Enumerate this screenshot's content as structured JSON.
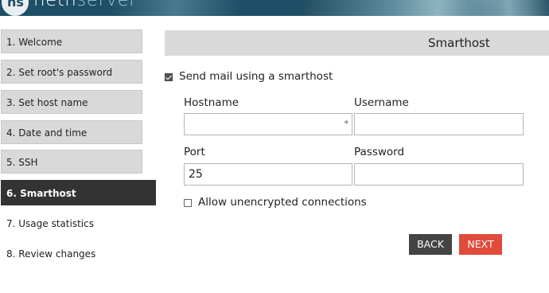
{
  "brand": {
    "badge": "ns",
    "name_part1": "neth",
    "name_part2": "server"
  },
  "steps": [
    {
      "label": "1. Welcome",
      "active": false
    },
    {
      "label": "2. Set root's password",
      "active": false
    },
    {
      "label": "3. Set host name",
      "active": false
    },
    {
      "label": "4. Date and time",
      "active": false
    },
    {
      "label": "5. SSH",
      "active": false
    },
    {
      "label": "6. Smarthost",
      "active": true
    },
    {
      "label": "7. Usage statistics",
      "active": false
    },
    {
      "label": "8. Review changes",
      "active": false
    }
  ],
  "panel": {
    "title": "Smarthost"
  },
  "form": {
    "send_mail_label": "Send mail using a smarthost",
    "send_mail_checked": true,
    "hostname": {
      "label": "Hostname",
      "value": "",
      "required_mark": "*"
    },
    "username": {
      "label": "Username",
      "value": ""
    },
    "port": {
      "label": "Port",
      "value": "25"
    },
    "password": {
      "label": "Password",
      "value": ""
    },
    "allow_unencrypted_label": "Allow unencrypted connections",
    "allow_unencrypted_checked": false
  },
  "buttons": {
    "back": "BACK",
    "next": "NEXT"
  },
  "colors": {
    "header": "#1d4f66",
    "active_step": "#333333",
    "next_button": "#e04b3c",
    "back_button": "#444444"
  }
}
